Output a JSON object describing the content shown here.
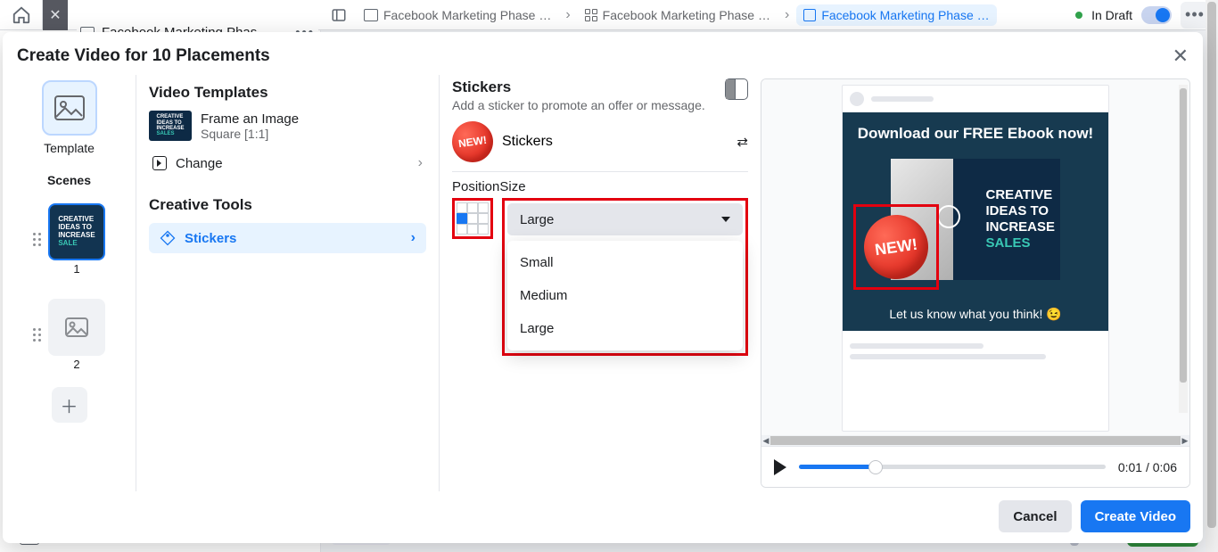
{
  "topbar": {
    "left_tab": "Facebook Marketing Phas…",
    "crumbs": [
      {
        "icon": "folder",
        "label": "Facebook Marketing Phase …"
      },
      {
        "icon": "grid",
        "label": "Facebook Marketing Phase …"
      },
      {
        "icon": "square",
        "label": "Facebook Marketing Phase …",
        "active": true
      }
    ],
    "status": "In Draft"
  },
  "modal": {
    "title": "Create Video for 10 Placements",
    "rail": {
      "template_label": "Template",
      "scenes_heading": "Scenes",
      "scene1_num": "1",
      "scene2_num": "2",
      "scene1_text_top": "CREATIVE",
      "scene1_text_mid": "IDEAS TO",
      "scene1_text_mid2": "INCREASE",
      "scene1_text_bot": "SALE"
    },
    "middle": {
      "video_templates": "Video Templates",
      "frame_name": "Frame an Image",
      "frame_sub": "Square [1:1]",
      "change": "Change",
      "creative_tools": "Creative Tools",
      "stickers": "Stickers"
    },
    "cfg": {
      "title": "Stickers",
      "sub": "Add a sticker to promote an offer or message.",
      "sticker_label": "Stickers",
      "new_badge": "NEW!",
      "pos_label": "Position",
      "size_label": "Size",
      "selected_size": "Large",
      "options": [
        "Small",
        "Medium",
        "Large"
      ]
    },
    "preview": {
      "headline": "Download our FREE Ebook now!",
      "line1": "CREATIVE",
      "line2": "IDEAS TO",
      "line3": "INCREASE",
      "line4": "SALES",
      "new_badge": "NEW!",
      "caption": "Let us know what you think! 😉",
      "time": "0:01 / 0:06"
    },
    "footer": {
      "cancel": "Cancel",
      "create": "Create Video"
    }
  }
}
